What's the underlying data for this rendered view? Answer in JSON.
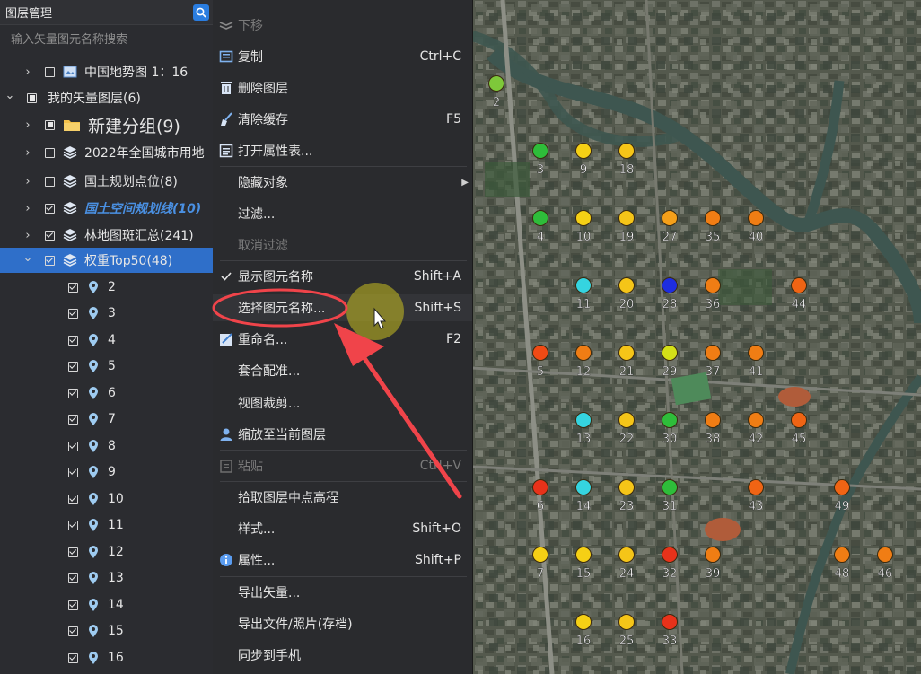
{
  "panel": {
    "title": "图层管理",
    "search_placeholder": "输入矢量图元名称搜索",
    "rows": [
      {
        "label": "中国地势图 1：16",
        "level": 1,
        "chevron": "right",
        "check": "none",
        "icon": "image-layer-icon"
      },
      {
        "label": "我的矢量图层(6)",
        "level": 0,
        "chevron": "down",
        "check": "partial",
        "icon": ""
      },
      {
        "label": "新建分组(9)",
        "level": 1,
        "chevron": "right",
        "check": "partial",
        "icon": "folder-icon"
      },
      {
        "label": "2022年全国城市用地",
        "level": 1,
        "chevron": "right",
        "check": "none",
        "icon": "layers-icon"
      },
      {
        "label": "国土规划点位(8)",
        "level": 1,
        "chevron": "right",
        "check": "none",
        "icon": "layers-icon"
      },
      {
        "label": "国土空间规划线(10)",
        "level": 1,
        "chevron": "right",
        "check": "checked",
        "icon": "layers-icon"
      },
      {
        "label": "林地图斑汇总(241)",
        "level": 1,
        "chevron": "right",
        "check": "checked",
        "icon": "layers-icon"
      },
      {
        "label": "权重Top50(48)",
        "level": 1,
        "chevron": "down",
        "check": "checked",
        "icon": "layers-icon"
      },
      {
        "label": "2",
        "level": 2,
        "check": "checked",
        "icon": "pin-icon"
      },
      {
        "label": "3",
        "level": 2,
        "check": "checked",
        "icon": "pin-icon"
      },
      {
        "label": "4",
        "level": 2,
        "check": "checked",
        "icon": "pin-icon"
      },
      {
        "label": "5",
        "level": 2,
        "check": "checked",
        "icon": "pin-icon"
      },
      {
        "label": "6",
        "level": 2,
        "check": "checked",
        "icon": "pin-icon"
      },
      {
        "label": "7",
        "level": 2,
        "check": "checked",
        "icon": "pin-icon"
      },
      {
        "label": "8",
        "level": 2,
        "check": "checked",
        "icon": "pin-icon"
      },
      {
        "label": "9",
        "level": 2,
        "check": "checked",
        "icon": "pin-icon"
      },
      {
        "label": "10",
        "level": 2,
        "check": "checked",
        "icon": "pin-icon"
      },
      {
        "label": "11",
        "level": 2,
        "check": "checked",
        "icon": "pin-icon"
      },
      {
        "label": "12",
        "level": 2,
        "check": "checked",
        "icon": "pin-icon"
      },
      {
        "label": "13",
        "level": 2,
        "check": "checked",
        "icon": "pin-icon"
      },
      {
        "label": "14",
        "level": 2,
        "check": "checked",
        "icon": "pin-icon"
      },
      {
        "label": "15",
        "level": 2,
        "check": "checked",
        "icon": "pin-icon"
      },
      {
        "label": "16",
        "level": 2,
        "check": "checked",
        "icon": "pin-icon"
      }
    ]
  },
  "menu": {
    "items": [
      {
        "label": "下移",
        "shortcut": "",
        "icon": "move-down-icon",
        "disabled": true
      },
      {
        "label": "复制",
        "shortcut": "Ctrl+C",
        "icon": "copy-icon"
      },
      {
        "label": "删除图层",
        "shortcut": "",
        "icon": "trash-icon"
      },
      {
        "label": "清除缓存",
        "shortcut": "F5",
        "icon": "broom-icon"
      },
      {
        "label": "打开属性表...",
        "shortcut": "",
        "icon": "table-icon",
        "sep_after": true
      },
      {
        "label": "隐藏对象",
        "shortcut": "",
        "icon": "",
        "submenu": true
      },
      {
        "label": "过滤...",
        "shortcut": "",
        "icon": ""
      },
      {
        "label": "取消过滤",
        "shortcut": "",
        "icon": "",
        "disabled": true,
        "sep_after": true
      },
      {
        "label": "显示图元名称",
        "shortcut": "Shift+A",
        "icon": "checkmark-icon"
      },
      {
        "label": "选择图元名称...",
        "shortcut": "Shift+S",
        "icon": "",
        "highlight": true
      },
      {
        "label": "重命名...",
        "shortcut": "F2",
        "icon": "rename-icon"
      },
      {
        "label": "套合配准...",
        "shortcut": "",
        "icon": ""
      },
      {
        "label": "视图裁剪...",
        "shortcut": "",
        "icon": ""
      },
      {
        "label": "缩放至当前图层",
        "shortcut": "",
        "icon": "user-zoom-icon",
        "sep_after": true
      },
      {
        "label": "粘贴",
        "shortcut": "Ctrl+V",
        "icon": "paste-icon",
        "disabled": true,
        "sep_after": true
      },
      {
        "label": "拾取图层中点高程",
        "shortcut": "",
        "icon": ""
      },
      {
        "label": "样式...",
        "shortcut": "Shift+O",
        "icon": ""
      },
      {
        "label": "属性...",
        "shortcut": "Shift+P",
        "icon": "info-icon",
        "sep_after": true
      },
      {
        "label": "导出矢量...",
        "shortcut": "",
        "icon": ""
      },
      {
        "label": "导出文件/照片(存档)",
        "shortcut": "",
        "icon": ""
      },
      {
        "label": "同步到手机",
        "shortcut": "",
        "icon": ""
      }
    ]
  },
  "map": {
    "points": [
      {
        "label": "2",
        "color": "#7ec83a"
      },
      {
        "label": "3",
        "color": "#2ebd3a"
      },
      {
        "label": "9",
        "color": "#f5d015"
      },
      {
        "label": "18",
        "color": "#f5c518"
      },
      {
        "label": "4",
        "color": "#2ebd3a"
      },
      {
        "label": "10",
        "color": "#f5d015"
      },
      {
        "label": "19",
        "color": "#f5c518"
      },
      {
        "label": "27",
        "color": "#f5a01a"
      },
      {
        "label": "35",
        "color": "#f07d14"
      },
      {
        "label": "40",
        "color": "#f07d14"
      },
      {
        "label": "11",
        "color": "#35d4e0"
      },
      {
        "label": "20",
        "color": "#f5c518"
      },
      {
        "label": "28",
        "color": "#1e2de0"
      },
      {
        "label": "36",
        "color": "#f07d14"
      },
      {
        "label": "44",
        "color": "#f06414"
      },
      {
        "label": "5",
        "color": "#f04a14"
      },
      {
        "label": "12",
        "color": "#f07d14"
      },
      {
        "label": "21",
        "color": "#f5c518"
      },
      {
        "label": "29",
        "color": "#d4e018"
      },
      {
        "label": "37",
        "color": "#f07d14"
      },
      {
        "label": "41",
        "color": "#f07d14"
      },
      {
        "label": "13",
        "color": "#35d4e0"
      },
      {
        "label": "22",
        "color": "#f5c518"
      },
      {
        "label": "30",
        "color": "#2ebd3a"
      },
      {
        "label": "38",
        "color": "#f07d14"
      },
      {
        "label": "42",
        "color": "#f07d14"
      },
      {
        "label": "45",
        "color": "#f06414"
      },
      {
        "label": "6",
        "color": "#e8321a"
      },
      {
        "label": "14",
        "color": "#35d4e0"
      },
      {
        "label": "23",
        "color": "#f5c518"
      },
      {
        "label": "31",
        "color": "#2ebd3a"
      },
      {
        "label": "43",
        "color": "#f06414"
      },
      {
        "label": "49",
        "color": "#f06414"
      },
      {
        "label": "7",
        "color": "#f5d015"
      },
      {
        "label": "15",
        "color": "#f5d015"
      },
      {
        "label": "24",
        "color": "#f5c518"
      },
      {
        "label": "32",
        "color": "#e8321a"
      },
      {
        "label": "39",
        "color": "#f07d14"
      },
      {
        "label": "48",
        "color": "#f07d14"
      },
      {
        "label": "46",
        "color": "#f07d14"
      },
      {
        "label": "16",
        "color": "#f5d015"
      },
      {
        "label": "25",
        "color": "#f5c518"
      },
      {
        "label": "33",
        "color": "#e8321a"
      }
    ]
  },
  "colors": {
    "selection": "#2f6fc9",
    "annotation_red": "#f0444a",
    "cursor_halo": "#c8c020"
  }
}
